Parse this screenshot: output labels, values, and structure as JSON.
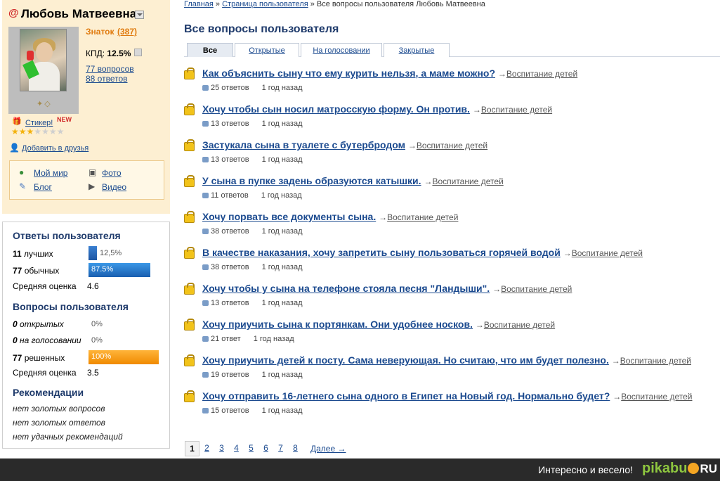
{
  "profile": {
    "at_icon": "@",
    "name": "Любовь Матвеевна",
    "rank": "Знаток",
    "points": "(387)",
    "kpd_label": "КПД:",
    "kpd_value": "12.5%",
    "questions_link": "77 вопросов",
    "answers_link": "88 ответов",
    "sticker_label": "Стикер!",
    "sticker_badge": "NEW",
    "stars": 3,
    "add_friend": "Добавить в друзья",
    "links": {
      "my_world": "Мой мир",
      "photo": "Фото",
      "blog": "Блог",
      "video": "Видео"
    }
  },
  "stats": {
    "answers_header": "Ответы пользователя",
    "best_count": "11",
    "best_label": "лучших",
    "best_pct": "12,5%",
    "best_fraction": 0.125,
    "normal_count": "77",
    "normal_label": "обычных",
    "normal_pct": "87.5%",
    "normal_fraction": 0.875,
    "avg_label": "Средняя оценка",
    "avg_answers": "4.6",
    "questions_header": "Вопросы пользователя",
    "open_count": "0",
    "open_label": "открытых",
    "open_pct": "0%",
    "voting_count": "0",
    "voting_label": "на голосовании",
    "voting_pct": "0%",
    "solved_count": "77",
    "solved_label": "решенных",
    "solved_pct": "100%",
    "solved_fraction": 1.0,
    "avg_questions": "3.5",
    "rec_header": "Рекомендации",
    "rec_items": [
      "нет золотых вопросов",
      "нет золотых ответов",
      "нет удачных рекомендаций"
    ]
  },
  "breadcrumb": {
    "home": "Главная",
    "sep": " » ",
    "user_page": "Страница пользователя",
    "current": "Все вопросы пользователя Любовь Матвеевна"
  },
  "page_title": "Все вопросы пользователя",
  "tabs": [
    "Все",
    "Открытые",
    "На голосовании",
    "Закрытые"
  ],
  "arrow": "→",
  "questions": [
    {
      "title": "Как объяснить сыну что ему курить нельзя, а маме можно?",
      "category": "Воспитание детей",
      "answers": "25 ответов",
      "ago": "1 год назад"
    },
    {
      "title": "Хочу чтобы сын носил матросскую форму. Он против.",
      "category": "Воспитание детей",
      "answers": "13 ответов",
      "ago": "1 год назад"
    },
    {
      "title": "Застукала сына в туалете с бутербродом",
      "category": "Воспитание детей",
      "answers": "13 ответов",
      "ago": "1 год назад"
    },
    {
      "title": "У сына в пупке задень образуются катышки.",
      "category": "Воспитание детей",
      "answers": "11 ответов",
      "ago": "1 год назад"
    },
    {
      "title": "Хочу порвать все документы сына.",
      "category": "Воспитание детей",
      "answers": "38 ответов",
      "ago": "1 год назад"
    },
    {
      "title": "В качестве наказания, хочу запретить сыну пользоваться горячей водой",
      "category": "Воспитание детей",
      "answers": "38 ответов",
      "ago": "1 год назад"
    },
    {
      "title": "Хочу чтобы у сына на телефоне стояла песня \"Ландыши\".",
      "category": "Воспитание детей",
      "answers": "13 ответов",
      "ago": "1 год назад"
    },
    {
      "title": "Хочу приучить сына к портянкам. Они удобнее носков.",
      "category": "Воспитание детей",
      "answers": "21 ответ",
      "ago": "1 год назад"
    },
    {
      "title": "Хочу приучить детей к посту. Сама неверующая. Но считаю, что им будет полезно.",
      "category": "Воспитание детей",
      "answers": "19 ответов",
      "ago": "1 год назад"
    },
    {
      "title": "Хочу отправить 16-летнего сына одного в Египет на Новый год. Нормально будет?",
      "category": "Воспитание детей",
      "answers": "15 ответов",
      "ago": "1 год назад"
    }
  ],
  "pager": {
    "pages": [
      "1",
      "2",
      "3",
      "4",
      "5",
      "6",
      "7",
      "8"
    ],
    "next": "Далее →"
  },
  "footer": {
    "slogan": "Интересно и весело!",
    "logo_main": "pikabu",
    "logo_ru": "RU"
  }
}
